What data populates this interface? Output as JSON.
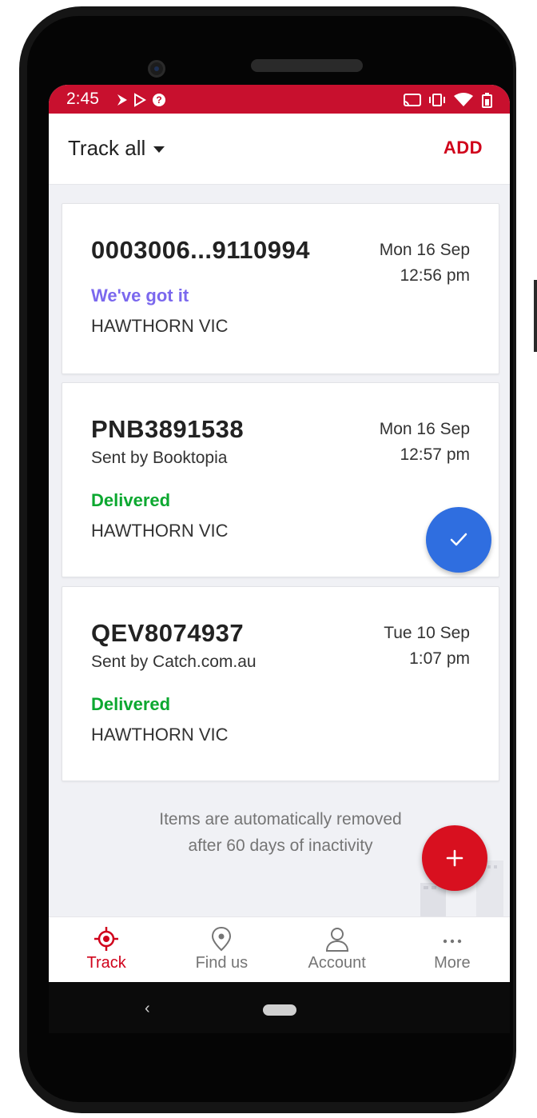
{
  "status_bar": {
    "time": "2:45",
    "left_icons": [
      "notification-icon",
      "play-store-icon",
      "help-icon"
    ],
    "right_icons": [
      "cast-icon",
      "vibrate-icon",
      "wifi-icon",
      "battery-icon"
    ],
    "color": "#c8102e"
  },
  "appbar": {
    "filter_label": "Track all",
    "add_label": "ADD"
  },
  "items": [
    {
      "tracking": "0003006...9110994",
      "sender": "",
      "status": "We've got it",
      "status_color": "#7b68ee",
      "location": "HAWTHORN VIC",
      "date": "Mon 16 Sep",
      "time": "12:56 pm"
    },
    {
      "tracking": "PNB3891538",
      "sender": "Sent by Booktopia",
      "status": "Delivered",
      "status_color": "#0ca830",
      "location": "HAWTHORN VIC",
      "date": "Mon 16 Sep",
      "time": "12:57 pm"
    },
    {
      "tracking": "QEV8074937",
      "sender": "Sent by Catch.com.au",
      "status": "Delivered",
      "status_color": "#0ca830",
      "location": "HAWTHORN VIC",
      "date": "Tue 10 Sep",
      "time": "1:07 pm"
    }
  ],
  "note": {
    "line1": "Items are automatically removed",
    "line2": "after 60 days of inactivity"
  },
  "fabs": {
    "check_icon": "check-icon",
    "add_icon": "plus-icon"
  },
  "bottom_nav": [
    {
      "label": "Track",
      "icon": "crosshair-icon",
      "active": true
    },
    {
      "label": "Find us",
      "icon": "location-pin-icon",
      "active": false
    },
    {
      "label": "Account",
      "icon": "person-icon",
      "active": false
    },
    {
      "label": "More",
      "icon": "more-dots-icon",
      "active": false
    }
  ],
  "colors": {
    "accent": "#d0021b",
    "fab_blue": "#2f6ee0",
    "delivered": "#0ca830",
    "in_progress": "#7b68ee"
  }
}
